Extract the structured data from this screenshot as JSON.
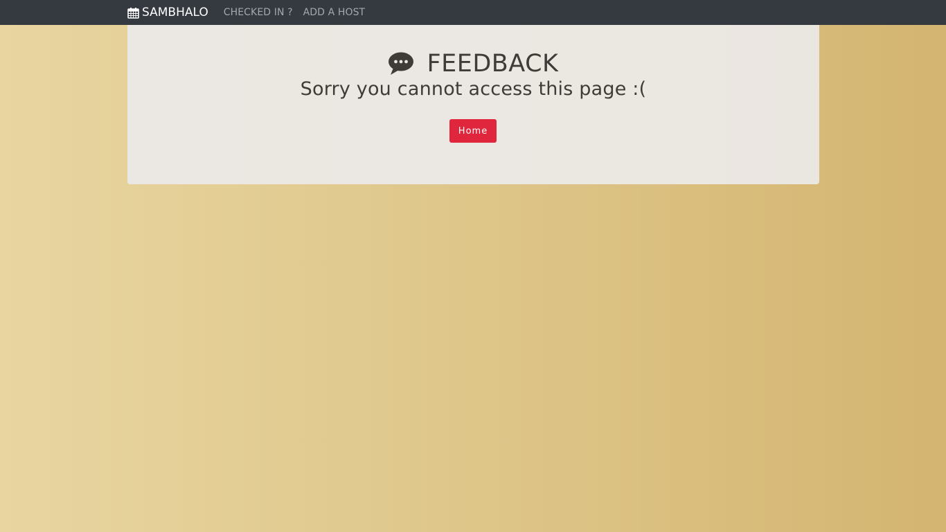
{
  "navbar": {
    "brand_icon": "calendar-icon",
    "brand_label": "SAMBHALO",
    "links": [
      {
        "label": "CHECKED IN ?"
      },
      {
        "label": "ADD A HOST"
      }
    ]
  },
  "card": {
    "title_icon": "speech-bubble-icon",
    "title": "FEEDBACK",
    "message": "Sorry you cannot access this page :(",
    "home_button_label": "Home"
  },
  "colors": {
    "navbar_bg": "#343a40",
    "button_bg": "#e0263d",
    "background_start": "#e8d5a0",
    "background_end": "#d4b571",
    "text": "#3f3b37"
  }
}
